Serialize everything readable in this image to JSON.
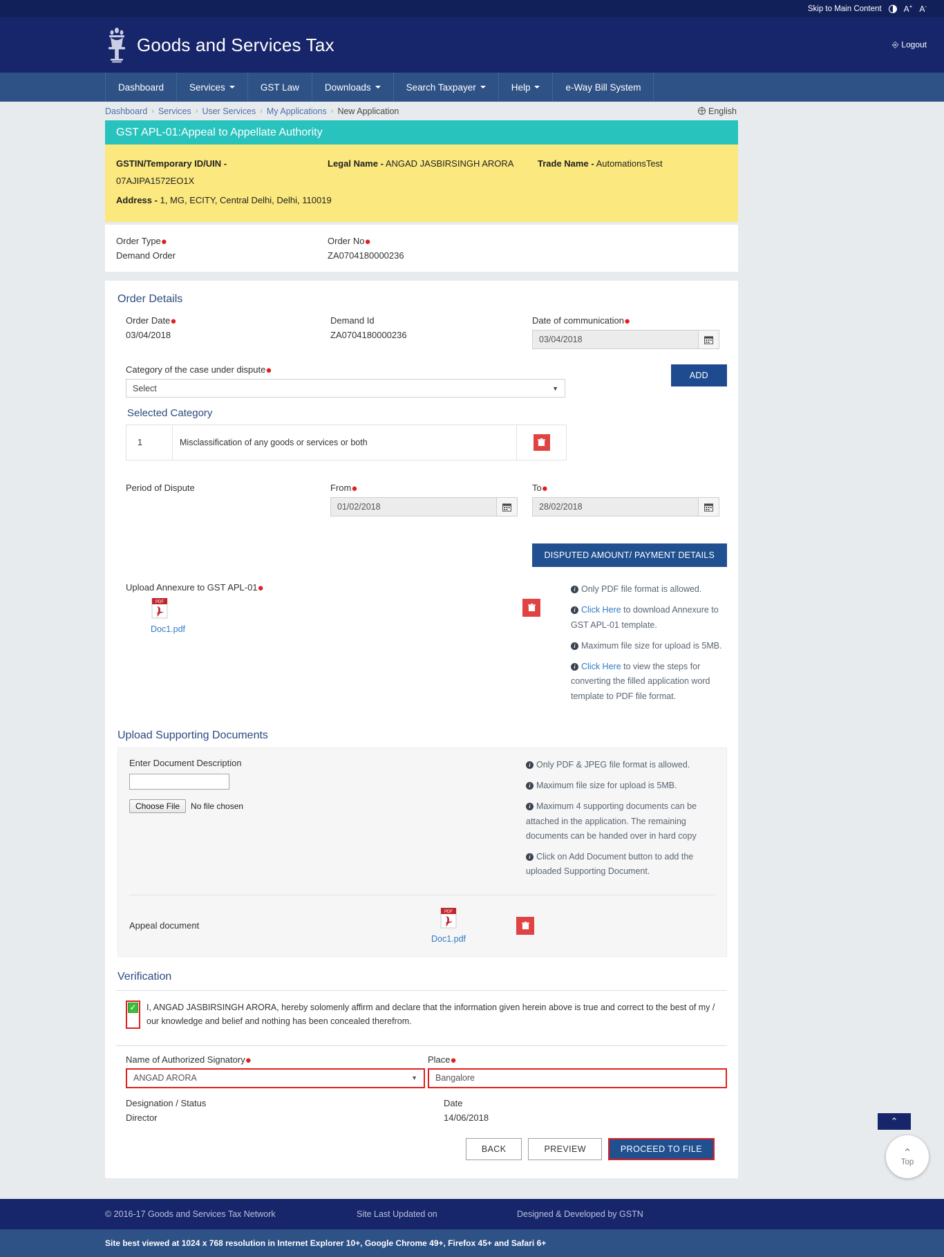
{
  "utilbar": {
    "skip": "Skip to Main Content",
    "contrast_icon": "contrast-icon",
    "font_increase": "A",
    "font_increase_sup": "+",
    "font_decrease": "A",
    "font_decrease_sup": "-"
  },
  "masthead": {
    "title": "Goods and Services Tax",
    "emblem": "national-emblem-icon",
    "logout": "Logout",
    "logout_icon": "logout-icon"
  },
  "nav": [
    {
      "label": "Dashboard",
      "caret": false
    },
    {
      "label": "Services",
      "caret": true
    },
    {
      "label": "GST Law",
      "caret": false
    },
    {
      "label": "Downloads",
      "caret": true
    },
    {
      "label": "Search Taxpayer",
      "caret": true
    },
    {
      "label": "Help",
      "caret": true
    },
    {
      "label": "e-Way Bill System",
      "caret": false
    }
  ],
  "breadcrumb": {
    "items": [
      "Dashboard",
      "Services",
      "User Services",
      "My Applications"
    ],
    "current": "New Application",
    "separator": "›",
    "language": "English"
  },
  "page_title": "GST APL-01:Appeal to Appellate Authority",
  "taxpayer": {
    "gstin_label": "GSTIN/Temporary ID/UIN -",
    "gstin_value": "07AJIPA1572EO1X",
    "legal_name_label": "Legal Name -",
    "legal_name_value": "ANGAD JASBIRSINGH ARORA",
    "trade_name_label": "Trade Name -",
    "trade_name_value": "AutomationsTest",
    "address_label": "Address -",
    "address_value": "1, MG, ECITY, Central Delhi, Delhi, 110019"
  },
  "order_head": {
    "order_type_label": "Order Type",
    "order_type_value": "Demand Order",
    "order_no_label": "Order No",
    "order_no_value": "ZA0704180000236"
  },
  "order_details": {
    "heading": "Order Details",
    "order_date_label": "Order Date",
    "order_date_value": "03/04/2018",
    "demand_id_label": "Demand Id",
    "demand_id_value": "ZA0704180000236",
    "date_comm_label": "Date of communication",
    "date_comm_value": "03/04/2018",
    "category_label": "Category of the case under dispute",
    "category_selected": "Select",
    "add_button": "ADD",
    "selected_category_heading": "Selected Category",
    "selected_categories": [
      {
        "index": "1",
        "name": "Misclassification of any goods or services or both"
      }
    ]
  },
  "period": {
    "label": "Period of Dispute",
    "from_label": "From",
    "from_value": "01/02/2018",
    "to_label": "To",
    "to_value": "28/02/2018",
    "disputed_button": "DISPUTED AMOUNT/ PAYMENT DETAILS"
  },
  "annexure": {
    "label": "Upload Annexure to GST APL-01",
    "file_name": "Doc1.pdf",
    "file_icon": "pdf-file-icon",
    "delete_icon": "trash-icon",
    "info": [
      {
        "text": "Only PDF file format is allowed.",
        "link": null
      },
      {
        "link": "Click Here",
        "text": " to download Annexure to GST APL-01 template."
      },
      {
        "text": "Maximum file size for upload is 5MB.",
        "link": null
      },
      {
        "link": "Click Here",
        "text": " to view the steps for converting the filled application word template to PDF file format."
      }
    ]
  },
  "supporting": {
    "heading": "Upload Supporting Documents",
    "desc_label": "Enter Document Description",
    "desc_value": "",
    "choose_file_label": "Choose File",
    "no_file_label": "No file chosen",
    "info": [
      {
        "text": "Only PDF & JPEG file format is allowed.",
        "link": null
      },
      {
        "text": "Maximum file size for upload is 5MB.",
        "link": null
      },
      {
        "text": "Maximum 4 supporting documents can be attached in the application. The remaining documents can be handed over in hard copy",
        "link": null
      },
      {
        "text": "Click on Add Document button to add the uploaded Supporting Document.",
        "link": null
      }
    ],
    "rows": [
      {
        "description": "Appeal document",
        "file_name": "Doc1.pdf",
        "file_icon": "pdf-file-icon",
        "delete_icon": "trash-icon"
      }
    ]
  },
  "verification": {
    "heading": "Verification",
    "checkbox_checked": true,
    "check_glyph": "✓",
    "declaration": "I, ANGAD JASBIRSINGH ARORA, hereby solomenly affirm and declare that the information given herein above is true and correct to the best of my / our knowledge and belief and nothing has been concealed therefrom.",
    "signatory_label": "Name of Authorized Signatory",
    "signatory_value": "ANGAD ARORA",
    "place_label": "Place",
    "place_value": "Bangalore",
    "designation_label": "Designation / Status",
    "designation_value": "Director",
    "date_label": "Date",
    "date_value": "14/06/2018"
  },
  "actions": {
    "back": "BACK",
    "preview": "PREVIEW",
    "proceed": "PROCEED TO FILE"
  },
  "footer": {
    "copyright": "© 2016-17 Goods and Services Tax Network",
    "last_updated": "Site Last Updated on",
    "designed": "Designed & Developed by GSTN",
    "browser_note": "Site best viewed at 1024 x 768 resolution in Internet Explorer 10+, Google Chrome 49+, Firefox 45+ and Safari 6+"
  },
  "scroll_top": {
    "label": "Top",
    "chevron": "⌃",
    "tab_chevron": "⌃"
  },
  "colors": {
    "navy": "#17266b",
    "nav_blue": "#2e5186",
    "teal": "#29c3be",
    "yellow": "#fbe87f",
    "accent_blue": "#20508f",
    "red": "#e02020",
    "link": "#2f7ac7"
  }
}
